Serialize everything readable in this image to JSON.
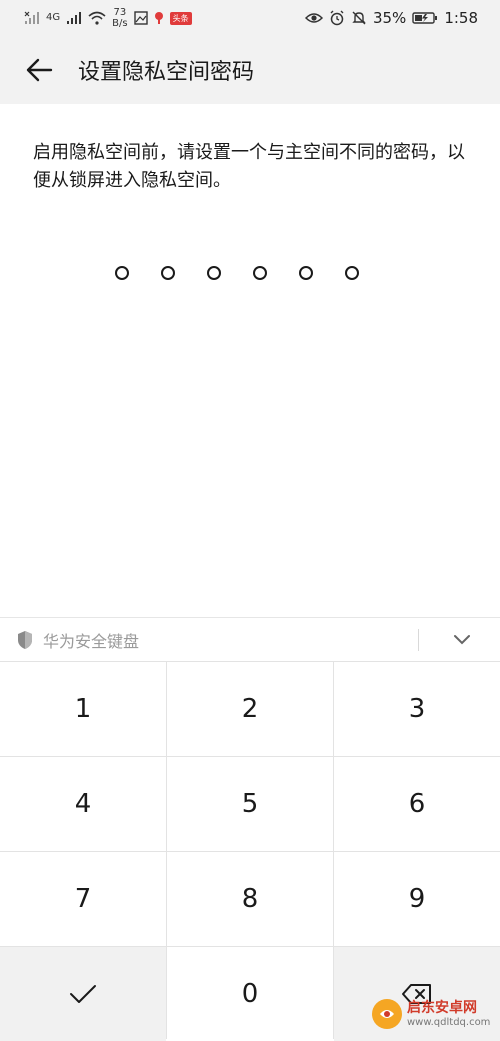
{
  "status_bar": {
    "net_speed_value": "73",
    "net_speed_unit": "B/s",
    "network_type": "4G",
    "notification_tag": "头条",
    "battery": "35%",
    "time": "1:58"
  },
  "app_bar": {
    "title": "设置隐私空间密码"
  },
  "description": "启用隐私空间前，请设置一个与主空间不同的密码，以便从锁屏进入隐私空间。",
  "pin": {
    "length": 6,
    "entered": 0
  },
  "keyboard": {
    "title": "华为安全键盘",
    "keys": [
      "1",
      "2",
      "3",
      "4",
      "5",
      "6",
      "7",
      "8",
      "9",
      "0"
    ]
  },
  "watermark": {
    "brand": "启东安卓网",
    "url": "www.qdltdq.com"
  },
  "colors": {
    "header_bg": "#f2f2f2",
    "key_bg": "#ffffff",
    "func_key_bg": "#f1f1f1",
    "divider": "#e3e3e3"
  }
}
